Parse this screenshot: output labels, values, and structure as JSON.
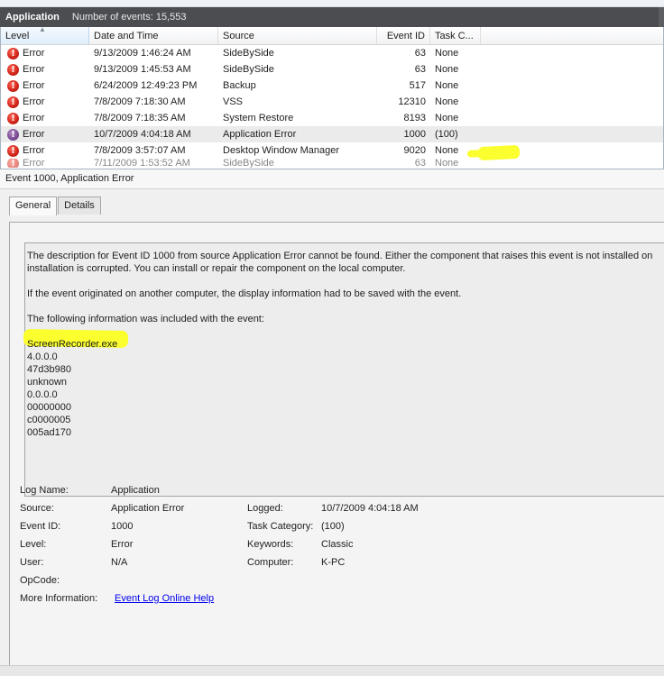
{
  "title_bar": {
    "app_name": "Application",
    "event_count": "Number of events: 15,553"
  },
  "list": {
    "columns": [
      "Level",
      "Date and Time",
      "Source",
      "Event ID",
      "Task C..."
    ],
    "rows": [
      {
        "level": "Error",
        "date": "9/13/2009 1:46:24 AM",
        "source": "SideBySide",
        "id": "63",
        "task": "None"
      },
      {
        "level": "Error",
        "date": "9/13/2009 1:45:53 AM",
        "source": "SideBySide",
        "id": "63",
        "task": "None"
      },
      {
        "level": "Error",
        "date": "6/24/2009 12:49:23 PM",
        "source": "Backup",
        "id": "517",
        "task": "None"
      },
      {
        "level": "Error",
        "date": "7/8/2009 7:18:30 AM",
        "source": "VSS",
        "id": "12310",
        "task": "None"
      },
      {
        "level": "Error",
        "date": "7/8/2009 7:18:35 AM",
        "source": "System Restore",
        "id": "8193",
        "task": "None"
      },
      {
        "level": "Error",
        "date": "10/7/2009 4:04:18 AM",
        "source": "Application Error",
        "id": "1000",
        "task": "(100)"
      },
      {
        "level": "Error",
        "date": "7/8/2009 3:57:07 AM",
        "source": "Desktop Window Manager",
        "id": "9020",
        "task": "None"
      }
    ],
    "partial_row": {
      "level": "Error",
      "date": "7/11/2009 1:53:52 AM",
      "source": "SideBySide",
      "id": "63",
      "task": "None"
    }
  },
  "detail": {
    "title": "Event 1000, Application Error",
    "tabs": [
      "General",
      "Details"
    ],
    "description": {
      "line1": "The description for Event ID 1000 from source Application Error cannot be found. Either the component that raises this event is not installed on",
      "line2": "installation is corrupted. You can install or repair the component on the local computer.",
      "line3": "If the event originated on another computer, the display information had to be saved with the event.",
      "line4": "The following information was included with the event:",
      "values": [
        "ScreenRecorder.exe",
        "4.0.0.0",
        "47d3b980",
        "unknown",
        "0.0.0.0",
        "00000000",
        "c0000005",
        "005ad170"
      ]
    },
    "properties": {
      "log_name_label": "Log Name:",
      "log_name": "Application",
      "source_label": "Source:",
      "source": "Application Error",
      "logged_label": "Logged:",
      "logged": "10/7/2009 4:04:18 AM",
      "event_id_label": "Event ID:",
      "event_id": "1000",
      "task_category_label": "Task Category:",
      "task_category": "(100)",
      "level_label": "Level:",
      "level": "Error",
      "keywords_label": "Keywords:",
      "keywords": "Classic",
      "user_label": "User:",
      "user": "N/A",
      "computer_label": "Computer:",
      "computer": "K-PC",
      "opcode_label": "OpCode:",
      "opcode": "",
      "more_info_label": "More Information:",
      "more_info_link": "Event Log Online Help"
    }
  },
  "colors": {
    "title_bar": "#4b4d51",
    "error_icon": "#d3261a",
    "highlight": "#fbff2e",
    "link": "#0000ee"
  }
}
